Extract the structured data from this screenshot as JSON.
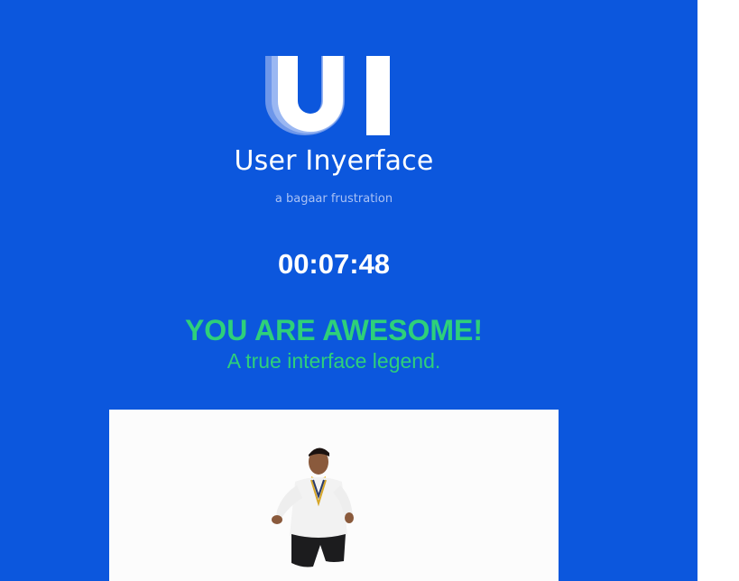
{
  "brand": {
    "logo_letters": "UI",
    "name": "User Inyerface",
    "tagline": "a bagaar frustration"
  },
  "result": {
    "timer": "00:07:48",
    "headline": "YOU ARE AWESOME!",
    "subheadline": "A true interface legend."
  },
  "media": {
    "image": "dancing-person-celebration"
  },
  "colors": {
    "background": "#0c57dd",
    "accent_green": "#2ed07a",
    "tagline": "#a9c1f5",
    "logo_light": "#7fa6f0",
    "logo_mid": "#b7cdf8"
  }
}
